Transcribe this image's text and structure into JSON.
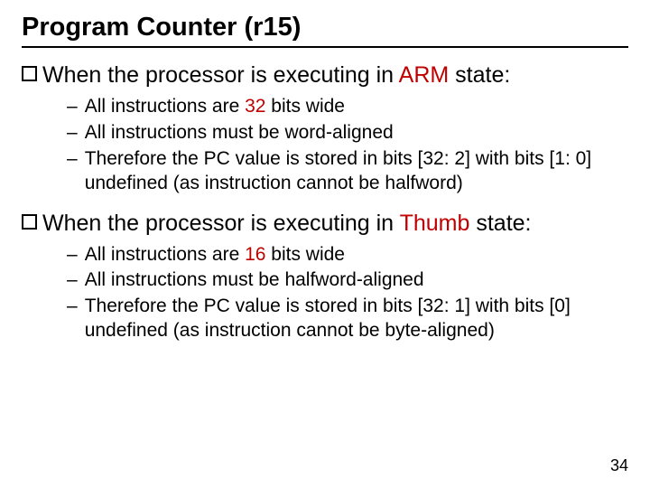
{
  "title": "Program Counter (r15)",
  "arm": {
    "heading_pre": "When the processor is executing in ",
    "heading_red": "ARM",
    "heading_post": " state:",
    "sub1_pre": "All instructions are ",
    "sub1_red": "32",
    "sub1_post": " bits wide",
    "sub2": "All instructions must be word-aligned",
    "sub3": "Therefore the PC value is stored in bits [32: 2] with bits [1: 0] undefined (as instruction cannot be halfword)"
  },
  "thumb": {
    "heading_pre": "When the processor is executing in ",
    "heading_red": "Thumb",
    "heading_post": " state:",
    "sub1_pre": "All instructions are ",
    "sub1_red": "16",
    "sub1_post": " bits wide",
    "sub2": "All instructions must be halfword-aligned",
    "sub3": "Therefore the PC value is stored in bits [32: 1] with bits [0] undefined (as instruction cannot be byte-aligned)"
  },
  "page_number": "34",
  "dash": "–"
}
